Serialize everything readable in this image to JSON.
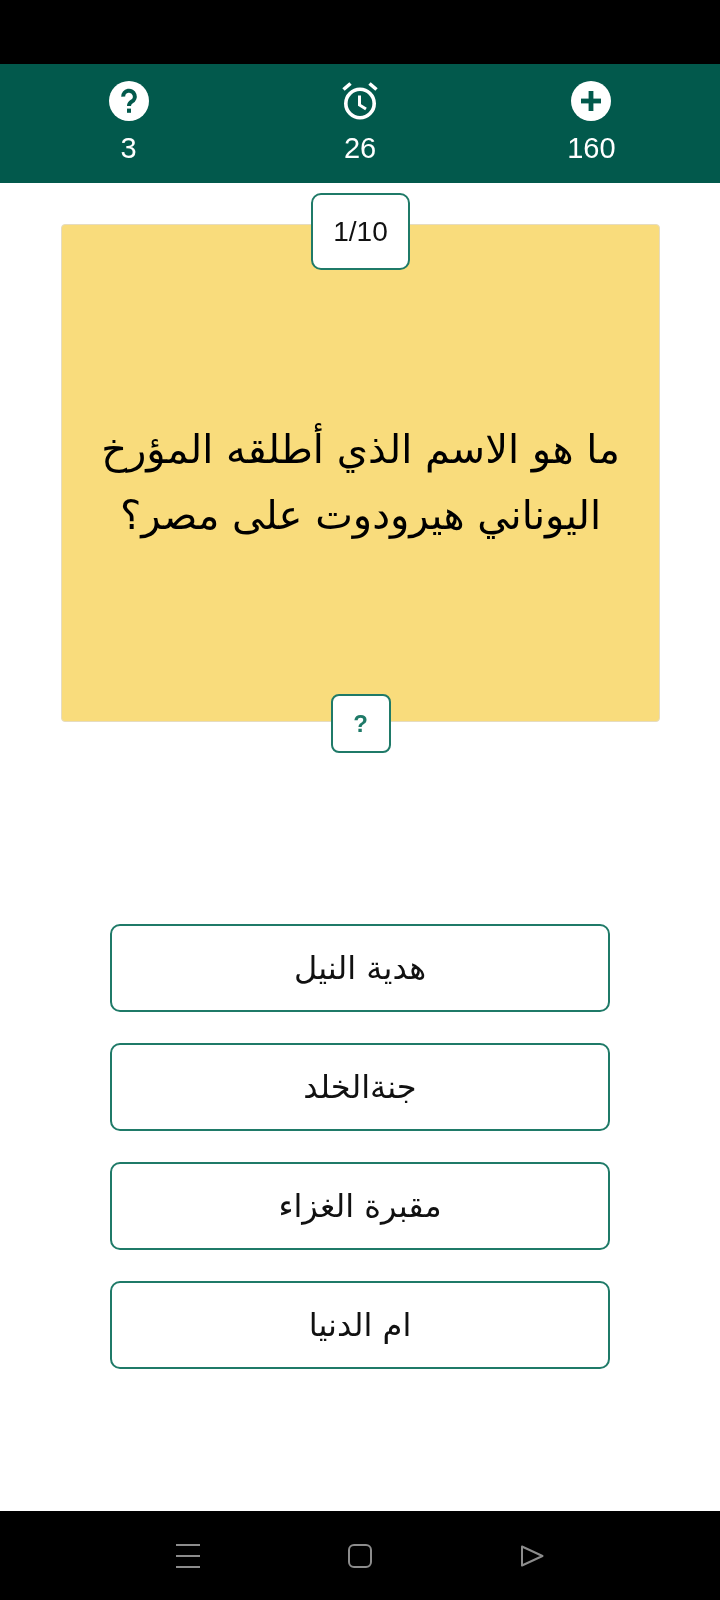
{
  "header": {
    "stats": [
      {
        "kind": "score",
        "value": "160"
      },
      {
        "kind": "timer",
        "value": "26"
      },
      {
        "kind": "hints",
        "value": "3"
      }
    ]
  },
  "question": {
    "counter": "1/10",
    "text": "ما هو الاسم الذي أطلقه المؤرخ اليوناني هيرودوت على مصر؟",
    "hint_button": "?"
  },
  "answers": [
    "هدية النيل",
    "جنةالخلد",
    "مقبرة الغزاء",
    "ام الدنيا"
  ]
}
